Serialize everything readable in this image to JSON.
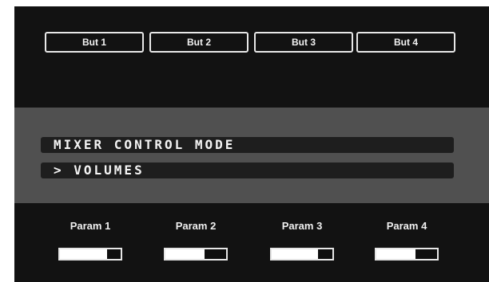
{
  "colors": {
    "screen_background": "#121212",
    "menu_band": "#505050",
    "menu_bar": "#1e1e1e",
    "text": "#f2f2f2"
  },
  "buttons": [
    {
      "label": "But 1"
    },
    {
      "label": "But 2"
    },
    {
      "label": "But 3"
    },
    {
      "label": "But 4"
    }
  ],
  "menu": {
    "title": "MIXER CONTROL MODE",
    "item": "> VOLUMES"
  },
  "params": [
    {
      "label": "Param 1",
      "level": 0.78
    },
    {
      "label": "Param 2",
      "level": 0.65
    },
    {
      "label": "Param 3",
      "level": 0.76
    },
    {
      "label": "Param 4",
      "level": 0.64
    }
  ]
}
